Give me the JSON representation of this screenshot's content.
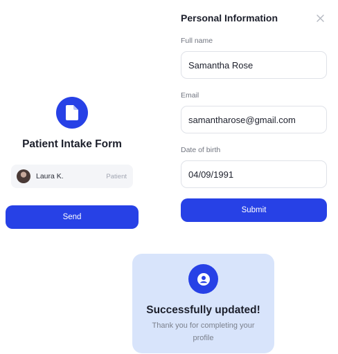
{
  "intake": {
    "title": "Patient Intake Form",
    "patient": {
      "name": "Laura K.",
      "role": "Patient"
    },
    "send_label": "Send",
    "doc_icon": "document-icon"
  },
  "personal_info": {
    "title": "Personal Information",
    "close_icon": "close-icon",
    "fields": {
      "full_name": {
        "label": "Full name",
        "value": "Samantha Rose"
      },
      "email": {
        "label": "Email",
        "value": "samantharose@gmail.com"
      },
      "dob": {
        "label": "Date of birth",
        "value": "04/09/1991"
      }
    },
    "submit_label": "Submit"
  },
  "success": {
    "icon": "user-circle-icon",
    "title": "Successfully updated!",
    "message": "Thank you for completing your profile"
  },
  "colors": {
    "accent": "#2741e6",
    "success_bg": "#d8e4fb",
    "chip_bg": "#f4f5f8"
  }
}
